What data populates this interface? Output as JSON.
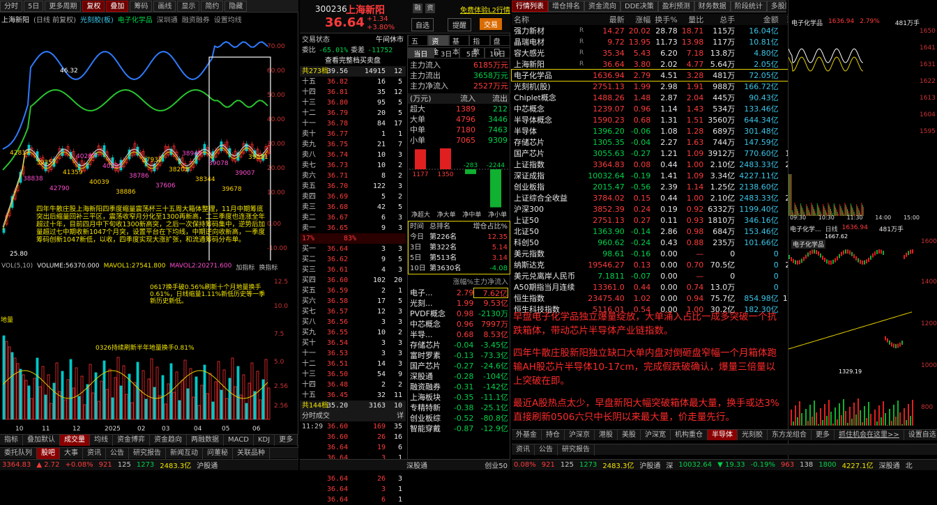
{
  "left_toolbar": [
    "分时",
    "5日",
    "更多周期",
    "复权",
    "叠加",
    "筹码",
    "画线",
    "显示",
    "简约",
    "隐藏"
  ],
  "left_title": {
    "name": "上海新阳",
    "mode": "(日线 前复权)",
    "stock2": "光刻胶(板)",
    "stock3": "电子化学品",
    "tools": [
      "深圳通",
      "融资融券",
      "设置均线"
    ]
  },
  "price_axis": [
    "70.00",
    "60.00",
    "50.00",
    "40.00",
    "30.00",
    "20.00",
    "10.00",
    "0.00",
    "-10.00"
  ],
  "price_marks": {
    "max": "46.32",
    "min": "25.80"
  },
  "price_labels": [
    "42817",
    "38838",
    "39357",
    "42790",
    "41359",
    "40287",
    "40039",
    "40225",
    "38886",
    "38786",
    "37932",
    "37606",
    "38201",
    "38949",
    "38344",
    "39078",
    "39678",
    "39007",
    "39551"
  ],
  "left_note": "四年牛散庄股上海新阳四季度缩量震荡杯三十五周大箱体整理，11月中期筹底突出后缩量回补三平区，震荡收窄月分化至1300再新高，二三季度也连涨全年超过十年，目前四月中下旬收1300新高突，之后一次保持筹码集中，逆势后加量超过七中期收新1047个月突，设置平台在下均线，中期逆向收新高，一季度筹码创新1047新低，以收，四季度实现大涨扩张，和流通筹码分布单。",
  "vol_header": {
    "vol": "VOL(5,10)",
    "volume": "VOLUME:56370.000",
    "ma5": "MAVOL1:27541.800",
    "ma10": "MAVOL2:20271.600",
    "tools": [
      "加指标",
      "换指标"
    ]
  },
  "vol_notes": [
    "0617换手破0.56%刷新十个月地量换手0.61%，日线缩量1.11%新低历史等一季新历史新低。",
    "0326持续刷新半年地量换手0.81%"
  ],
  "vol_axis": [
    "12.5",
    "10.0",
    "7.5",
    "5.0",
    "2.56",
    "2.56"
  ],
  "vol_side_label": "地量",
  "x_axis": [
    "10",
    "11",
    "12",
    "2025",
    "02",
    "03",
    "04",
    "05",
    "06"
  ],
  "left_tabs": [
    "指标",
    "叠加默认",
    "成交量",
    "均线",
    "资金博弈",
    "资金趋向",
    "两融数据",
    "MACD",
    "KDJ",
    "更多",
    "模板"
  ],
  "left_bottom_tabs": [
    "委托队列",
    "股吧",
    "大事",
    "资讯",
    "公告",
    "研究报告",
    "新闻互动",
    "问董秘",
    "关联品种"
  ],
  "status_left": {
    "index": "3364.83",
    "chg": "▲ 2.72",
    "pct": "+0.08%",
    "up": "921",
    "flat": "125",
    "down": "1273",
    "amt": "2483.3亿",
    "label": "沪股通"
  },
  "mid_header": {
    "code": "300236",
    "name": "上海新阳",
    "icons": [
      "融",
      "资"
    ],
    "link": "免费体验L2行情",
    "price": "36.64",
    "chg": "+1.34",
    "pct": "+3.80%",
    "btn1": "自选",
    "btn2": "提醒",
    "btn3": "交易"
  },
  "mid_market": {
    "label": "交易状态",
    "status": "午间休市",
    "weibi_label": "委比",
    "weibi": "-65.01%",
    "weicha_label": "委差",
    "weicha": "-11752",
    "btn": "查看完整档买卖盘",
    "total_label": "共273档",
    "total_price": "39.56",
    "total_vol": "14915",
    "total_n": "12"
  },
  "sell_book": [
    {
      "l": "十五",
      "p": "36.82",
      "v": "16",
      "n": "5"
    },
    {
      "l": "十四",
      "p": "36.81",
      "v": "35",
      "n": "12"
    },
    {
      "l": "十三",
      "p": "36.80",
      "v": "95",
      "n": "5"
    },
    {
      "l": "十二",
      "p": "36.79",
      "v": "20",
      "n": "5"
    },
    {
      "l": "十一",
      "p": "36.78",
      "v": "84",
      "n": "17"
    },
    {
      "l": "卖十",
      "p": "36.77",
      "v": "1",
      "n": "1"
    },
    {
      "l": "卖九",
      "p": "36.75",
      "v": "21",
      "n": "7"
    },
    {
      "l": "卖八",
      "p": "36.74",
      "v": "10",
      "n": "3"
    },
    {
      "l": "卖七",
      "p": "36.73",
      "v": "10",
      "n": "2"
    },
    {
      "l": "卖六",
      "p": "36.71",
      "v": "8",
      "n": "2"
    },
    {
      "l": "卖五",
      "p": "36.70",
      "v": "122",
      "n": "3"
    },
    {
      "l": "卖四",
      "p": "36.69",
      "v": "5",
      "n": "2"
    },
    {
      "l": "卖三",
      "p": "36.68",
      "v": "42",
      "n": "5"
    },
    {
      "l": "卖二",
      "p": "36.67",
      "v": "6",
      "n": "3"
    },
    {
      "l": "卖一",
      "p": "36.65",
      "v": "9",
      "n": "3"
    }
  ],
  "book_ratio": {
    "sell": "17%",
    "buy": "83%"
  },
  "buy_book": [
    {
      "l": "买一",
      "p": "36.64",
      "v": "3",
      "n": "3"
    },
    {
      "l": "买二",
      "p": "36.62",
      "v": "9",
      "n": "5"
    },
    {
      "l": "买三",
      "p": "36.61",
      "v": "4",
      "n": "3"
    },
    {
      "l": "买四",
      "p": "36.60",
      "v": "102",
      "n": "20"
    },
    {
      "l": "买五",
      "p": "36.59",
      "v": "2",
      "n": "1"
    },
    {
      "l": "买六",
      "p": "36.58",
      "v": "17",
      "n": "5"
    },
    {
      "l": "买七",
      "p": "36.57",
      "v": "12",
      "n": "3"
    },
    {
      "l": "买八",
      "p": "36.56",
      "v": "3",
      "n": "3"
    },
    {
      "l": "买九",
      "p": "36.55",
      "v": "10",
      "n": "2"
    },
    {
      "l": "买十",
      "p": "36.54",
      "v": "3",
      "n": "3"
    },
    {
      "l": "十一",
      "p": "36.53",
      "v": "3",
      "n": "3"
    },
    {
      "l": "十二",
      "p": "36.51",
      "v": "14",
      "n": "3"
    },
    {
      "l": "十三",
      "p": "36.50",
      "v": "54",
      "n": "9"
    },
    {
      "l": "十四",
      "p": "36.48",
      "v": "2",
      "n": "2"
    },
    {
      "l": "十五",
      "p": "36.45",
      "v": "32",
      "n": "11"
    }
  ],
  "buy_total": {
    "label": "共144档",
    "price": "35.20",
    "vol": "3163",
    "n": "10"
  },
  "ticks_header": {
    "label": "分时成交",
    "more": "详"
  },
  "ticks": [
    {
      "t": "11:29",
      "p": "36.60",
      "v": "169",
      "n": "35"
    },
    {
      "t": "",
      "p": "36.60",
      "v": "26",
      "n": "16"
    },
    {
      "t": "",
      "p": "36.64",
      "v": "19",
      "n": "6"
    },
    {
      "t": "",
      "p": "36.64",
      "v": "3",
      "n": "1"
    },
    {
      "t": "",
      "p": "36.64",
      "v": "2",
      "n": "1"
    },
    {
      "t": "",
      "p": "36.64",
      "v": "26",
      "n": "3"
    },
    {
      "t": "",
      "p": "36.64",
      "v": "3",
      "n": "1"
    },
    {
      "t": "",
      "p": "36.64",
      "v": "6",
      "n": "1"
    }
  ],
  "fund_tabs": [
    "五档",
    "资金",
    "基本",
    "指数",
    "盘口"
  ],
  "fund_period": [
    "当日",
    "3日",
    "5日",
    "10日"
  ],
  "fund_flow": [
    {
      "l": "主力流入",
      "v": "6185万元"
    },
    {
      "l": "主力流出",
      "v": "3658万元"
    },
    {
      "l": "主力净流入",
      "v": "2527万元"
    }
  ],
  "fund_table_header": [
    "(万元)",
    "流入",
    "流出"
  ],
  "fund_table": [
    {
      "l": "超大",
      "in": "1389",
      "out": "212"
    },
    {
      "l": "大单",
      "in": "4796",
      "out": "3446"
    },
    {
      "l": "中单",
      "in": "7180",
      "out": "7463"
    },
    {
      "l": "小单",
      "in": "7065",
      "out": "9309"
    }
  ],
  "fund_bars": {
    "labels": [
      "1177",
      "1350",
      "-283",
      "-2244"
    ],
    "values": [
      1177,
      1350,
      -283,
      -2244
    ],
    "xlab": [
      "净超大",
      "净大单",
      "净中单",
      "净小单"
    ]
  },
  "rank_header": [
    "时间",
    "总排名",
    "增仓占比%"
  ],
  "rank_rows": [
    {
      "t": "今日",
      "r": "第226名",
      "v": "12.35"
    },
    {
      "t": "3日",
      "r": "第322名",
      "v": "5.14"
    },
    {
      "t": "5日",
      "r": "第513名",
      "v": "3.14"
    },
    {
      "t": "10日",
      "r": "第3630名",
      "v": "-4.08"
    }
  ],
  "sector_header": [
    "",
    "涨幅%",
    "主力净流入"
  ],
  "sectors": [
    {
      "n": "电子...",
      "p": "2.79",
      "f": "7.62亿"
    },
    {
      "n": "光刻...",
      "p": "1.99",
      "f": "9.53亿"
    },
    {
      "n": "PVDF概念",
      "p": "0.98",
      "f": "-2130万"
    },
    {
      "n": "中芯概念",
      "p": "0.96",
      "f": "7997万"
    },
    {
      "n": "半导...",
      "p": "0.68",
      "f": "8.53亿"
    },
    {
      "n": "存储芯片",
      "p": "-0.04",
      "f": "-3.45亿"
    },
    {
      "n": "富时罗素",
      "p": "-0.13",
      "f": "-73.3亿"
    },
    {
      "n": "国产芯片",
      "p": "-0.27",
      "f": "-24.6亿"
    },
    {
      "n": "深股通",
      "p": "-0.28",
      "f": "-104亿"
    },
    {
      "n": "融资融券",
      "p": "-0.31",
      "f": "-142亿"
    },
    {
      "n": "上海板块",
      "p": "-0.35",
      "f": "-11.1亿"
    },
    {
      "n": "专精特新",
      "p": "-0.38",
      "f": "-25.1亿"
    },
    {
      "n": "创业板综",
      "p": "-0.52",
      "f": "-80.8亿"
    },
    {
      "n": "智能穿戴",
      "p": "-0.87",
      "f": "-12.9亿"
    }
  ],
  "mid_status": {
    "label": "深股通",
    "idx": "创业50"
  },
  "right_tabs": [
    "行情列表",
    "增仓排名",
    "资金流向",
    "DDE决策",
    "盈利预测",
    "财务数据",
    "阶段统计",
    "多股同列"
  ],
  "table_header": [
    "名称",
    "最新",
    "涨幅",
    "换手%",
    "量比",
    "总手",
    "金额",
    "现量"
  ],
  "table_rows": [
    {
      "n": "强力新材",
      "f": "R",
      "p": "14.27",
      "c": "20.02",
      "t": "28.78",
      "r": "18.71",
      "v": "115万",
      "a": "16.04亿",
      "x": "2"
    },
    {
      "n": "晶瑞电材",
      "f": "R",
      "p": "9.72",
      "c": "13.95",
      "t": "11.73",
      "r": "13.98",
      "v": "117万",
      "a": "10.81亿",
      "x": "6"
    },
    {
      "n": "容大感光",
      "f": "R",
      "p": "35.34",
      "c": "5.43",
      "t": "6.20",
      "r": "7.18",
      "v": "13.8万",
      "a": "4.80亿",
      "x": "2"
    },
    {
      "n": "上海新阳",
      "f": "R",
      "p": "36.64",
      "c": "3.80",
      "t": "2.02",
      "r": "4.77",
      "v": "5.64万",
      "a": "2.05亿",
      "x": "1"
    },
    {
      "n": "电子化学品",
      "f": "",
      "p": "1636.94",
      "c": "2.79",
      "t": "4.51",
      "r": "3.28",
      "v": "481万",
      "a": "72.05亿",
      "x": "21"
    },
    {
      "n": "光刻机(股)",
      "f": "",
      "p": "2751.13",
      "c": "1.99",
      "t": "2.98",
      "r": "1.91",
      "v": "988万",
      "a": "166.72亿",
      "x": ""
    },
    {
      "n": "Chiplet概念",
      "f": "",
      "p": "1488.26",
      "c": "1.48",
      "t": "2.87",
      "r": "2.04",
      "v": "445万",
      "a": "90.43亿",
      "x": "17"
    },
    {
      "n": "中芯概念",
      "f": "",
      "p": "1239.07",
      "c": "0.96",
      "t": "1.14",
      "r": "1.43",
      "v": "534万",
      "a": "133.46亿",
      "x": "25"
    },
    {
      "n": "半导体概念",
      "f": "",
      "p": "1590.23",
      "c": "0.68",
      "t": "1.31",
      "r": "1.51",
      "v": "3560万",
      "a": "644.34亿",
      "x": ""
    },
    {
      "n": "半导体",
      "f": "",
      "p": "1396.20",
      "c": "-0.06",
      "t": "1.08",
      "r": "1.28",
      "v": "689万",
      "a": "301.48亿",
      "x": ""
    },
    {
      "n": "存储芯片",
      "f": "",
      "p": "1305.35",
      "c": "-0.04",
      "t": "2.27",
      "r": "1.63",
      "v": "744万",
      "a": "147.59亿",
      "x": "297"
    },
    {
      "n": "国产芯片",
      "f": "",
      "p": "3055.63",
      "c": "-0.27",
      "t": "1.21",
      "r": "1.09",
      "v": "3912万",
      "a": "770.60亿",
      "x": "1.07"
    },
    {
      "n": "上证指数",
      "f": "",
      "p": "3364.83",
      "c": "0.08",
      "t": "0.44",
      "r": "1.00",
      "v": "2.10亿",
      "a": "2483.33亿",
      "x": "2.32"
    },
    {
      "n": "深证成指",
      "f": "",
      "p": "10032.64",
      "c": "-0.19",
      "t": "1.41",
      "r": "1.09",
      "v": "3.34亿",
      "a": "4227.11亿",
      "x": "35"
    },
    {
      "n": "创业板指",
      "f": "",
      "p": "2015.47",
      "c": "-0.56",
      "t": "2.39",
      "r": "1.14",
      "v": "1.25亿",
      "a": "2138.60亿",
      "x": "35"
    },
    {
      "n": "上证综合全收益",
      "f": "",
      "p": "3784.02",
      "c": "0.15",
      "t": "0.44",
      "r": "1.00",
      "v": "2.10亿",
      "a": "2483.33亿",
      "x": "2.32"
    },
    {
      "n": "沪深300",
      "f": "",
      "p": "3852.39",
      "c": "0.24",
      "t": "0.19",
      "r": "0.92",
      "v": "6332万",
      "a": "1199.40亿",
      "x": "721"
    },
    {
      "n": "上证50",
      "f": "",
      "p": "2751.13",
      "c": "0.27",
      "t": "0.11",
      "r": "0.93",
      "v": "1810万",
      "a": "346.16亿",
      "x": ""
    },
    {
      "n": "北证50",
      "f": "",
      "p": "1363.90",
      "c": "-0.14",
      "t": "2.86",
      "r": "0.98",
      "v": "684万",
      "a": "153.46亿",
      "x": "257"
    },
    {
      "n": "科创50",
      "f": "",
      "p": "960.62",
      "c": "-0.24",
      "t": "0.43",
      "r": "0.88",
      "v": "235万",
      "a": "101.66亿",
      "x": "35"
    },
    {
      "n": "美元指数",
      "f": "",
      "p": "98.61",
      "c": "-0.16",
      "t": "0.00",
      "r": "—",
      "v": "0",
      "a": "0",
      "x": ""
    },
    {
      "n": "纳斯达克",
      "f": "",
      "p": "19546.27",
      "c": "0.13",
      "t": "0.00",
      "r": "0.70",
      "v": "70.5亿",
      "a": "0",
      "x": "27.1"
    },
    {
      "n": "美元兑离岸人民币",
      "f": "",
      "p": "7.1811",
      "c": "-0.07",
      "t": "0.00",
      "r": "—",
      "v": "0",
      "a": "0",
      "x": ""
    },
    {
      "n": "A50期指当月连续",
      "f": "",
      "p": "13361.0",
      "c": "0.44",
      "t": "0.00",
      "r": "0.74",
      "v": "13.0万",
      "a": "0",
      "x": ""
    },
    {
      "n": "恒生指数",
      "f": "",
      "p": "23475.40",
      "c": "1.02",
      "t": "0.00",
      "r": "0.94",
      "v": "75.7亿",
      "a": "854.98亿",
      "x": "1927"
    },
    {
      "n": "恒生科技指数",
      "f": "",
      "p": "5116.01",
      "c": "0.54",
      "t": "0.00",
      "r": "1.00",
      "v": "30.2亿",
      "a": "182.30亿",
      "x": ""
    }
  ],
  "commentary": [
    "早盘电子化学品独立爆量绽放，大单涌入占比一成多突破一个抗跌箱体，带动芯片半导体产业链指数。",
    "四年牛散庄股新阳独立缺口大单内盘对倒砸盘窄幅一个月箱体跑输AH股芯片半导体10-17cm，完成假跌破确认，爆量三倍量以上突破在即。",
    "最近A股热点太少，早盘新阳大幅突破箱体最大量，换手或达3%直接刷新0506六只中长阴以来最大量，价走量先行。"
  ],
  "right_tabs_bottom": [
    "外基金",
    "持仓",
    "沪深京",
    "港股",
    "美股",
    "沪深宽",
    "机构重仓",
    "半导体",
    "光刻胶",
    "东方龙组合",
    "更多"
  ],
  "right_link": "抓住机会在这里>>",
  "right_link2": "设置自选",
  "right_info_tabs": [
    "资讯",
    "公告",
    "研究报告"
  ],
  "status_right": {
    "pct": "0.08%",
    "up": "921",
    "flat": "125",
    "down": "1273",
    "amt": "2483.3亿",
    "label": "沪股通",
    "mk": "深",
    "idx": "10032.64",
    "chg": "▼ 19.33",
    "pct2": "-0.19%",
    "up2": "963",
    "flat2": "138",
    "down2": "1800",
    "amt2": "4227.1亿",
    "label2": "深股通",
    "tail": "北"
  },
  "mini1": {
    "name": "电子化学品",
    "price": "1636.94",
    "pct": "2.79%",
    "vol": "481万手",
    "axis": [
      "1650",
      "1641",
      "1631",
      "1622",
      "1613",
      "1604",
      "1595"
    ],
    "xtimes": [
      "09:30",
      "10:30",
      "11:30",
      "14:00",
      "15:00"
    ]
  },
  "mini2": {
    "name": "电子化学...",
    "mode": "日线",
    "price": "1636.94",
    "vol": "481万手",
    "label": "电子化学品",
    "high": "1667.62",
    "low": "1329.19",
    "axis": [
      "1600",
      "1400",
      "1200",
      "1000",
      "800"
    ]
  }
}
